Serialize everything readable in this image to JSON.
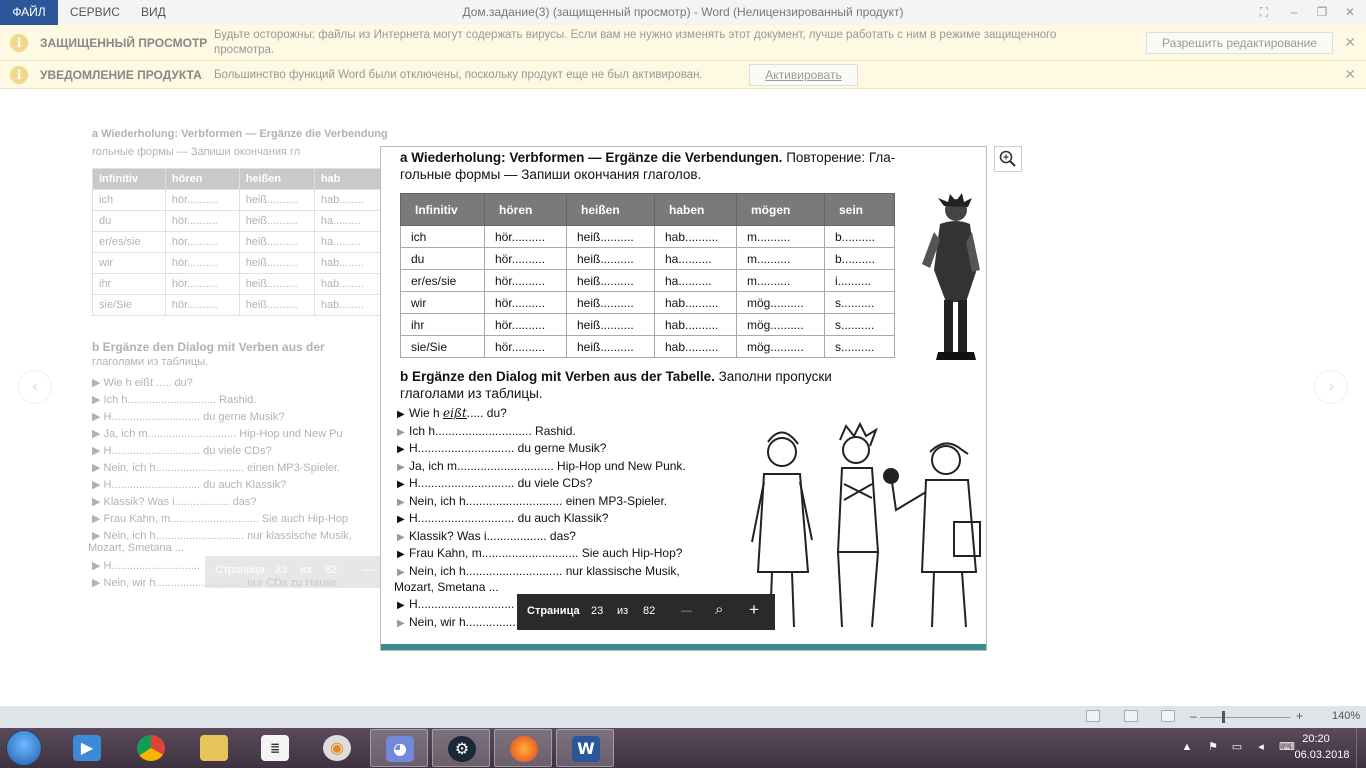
{
  "titlebar": {
    "menu": [
      "ФАЙЛ",
      "СЕРВИС",
      "ВИД"
    ],
    "title": "Дом.задание(3) (защищенный просмотр) - Word (Нелицензированный продукт)"
  },
  "protected_bar": {
    "title": "ЗАЩИЩЕННЫЙ ПРОСМОТР",
    "text_line1": "Будьте осторожны: файлы из Интернета могут содержать вирусы. Если вам не нужно изменять этот документ, лучше работать с ним в режиме защищенного",
    "text_line2": "просмотра.",
    "button": "Разрешить редактирование"
  },
  "product_bar": {
    "title": "УВЕДОМЛЕНИЕ ПРОДУКТА",
    "text": "Большинство функций Word были отключены, поскольку продукт еще не был активирован.",
    "button": "Активировать"
  },
  "background_page": {
    "heading_line1": "a  Wiederholung: Verbformen — Ergänze die Verbendungen. Повторение: Гла-",
    "heading_line2": "гольные формы — Запиши окончания гл",
    "table_headers": [
      "Infinitiv",
      "hören",
      "heißen",
      "hab"
    ],
    "table_rows": [
      [
        "ich",
        "hör..........",
        "heiß..........",
        "hab........"
      ],
      [
        "du",
        "hör..........",
        "heiß..........",
        "ha........."
      ],
      [
        "er/es/sie",
        "hör..........",
        "heiß..........",
        "ha........."
      ],
      [
        "wir",
        "hör..........",
        "heiß..........",
        "hab........"
      ],
      [
        "ihr",
        "hör..........",
        "heiß..........",
        "hab........"
      ],
      [
        "sie/Sie",
        "hör..........",
        "heiß..........",
        "hab........"
      ]
    ],
    "section_b_line1": "b  Ergänze den Dialog mit Verben aus der",
    "section_b_line2": "глаголами из таблицы.",
    "dialog": [
      "▶ Wie h  eißt  ..... du?",
      "▶ Ich h............................. Rashid.",
      "▶ H............................. du gerne Musik?",
      "▶ Ja, ich m............................. Hip-Hop und New Pu",
      "▶ H............................. du viele CDs?",
      "▶ Nein, ich h............................. einen MP3-Spieler.",
      "▶ H............................. du auch Klassik?",
      "▶ Klassik? Was i.................. das?",
      "▶ Frau Kahn, m............................. Sie auch Hip-Hop",
      "▶ Nein, ich h............................. nur klassische Musik,",
      "Mozart, Smetana ...",
      "▶ H.............................",
      "▶ Nein, wir h............................. nur CDs zu Hause."
    ],
    "pagebar": {
      "label": "Страница",
      "current": "23",
      "of": "из",
      "total": "82",
      "dash": "—"
    }
  },
  "zoom_image": {
    "heading_a_bold": "a  Wiederholung: Verbformen — Ergänze die Verbendungen.",
    "heading_a_rest": " Повторение: Гла-",
    "heading_a_line2": "гольные формы — Запиши окончания глаголов.",
    "table_headers": [
      "Infinitiv",
      "hören",
      "heißen",
      "haben",
      "mögen",
      "sein"
    ],
    "table_rows": [
      [
        "ich",
        "hör..........",
        "heiß..........",
        "hab..........",
        "m..........",
        "b.........."
      ],
      [
        "du",
        "hör..........",
        "heiß..........",
        "ha..........",
        "m..........",
        "b.........."
      ],
      [
        "er/es/sie",
        "hör..........",
        "heiß..........",
        "ha..........",
        "m..........",
        "i.........."
      ],
      [
        "wir",
        "hör..........",
        "heiß..........",
        "hab..........",
        "mög..........",
        "s.........."
      ],
      [
        "ihr",
        "hör..........",
        "heiß..........",
        "hab..........",
        "mög..........",
        "s.........."
      ],
      [
        "sie/Sie",
        "hör..........",
        "heiß..........",
        "hab..........",
        "mög..........",
        "s.........."
      ]
    ],
    "heading_b_bold": "b  Ergänze den Dialog mit Verben aus der Tabelle.",
    "heading_b_rest": " Заполни пропуски",
    "heading_b_line2": "глаголами из таблицы.",
    "dialog": [
      {
        "marker": "▶",
        "text": "Wie h ",
        "handwritten": "eißt",
        "after": "..... du?",
        "gray": false
      },
      {
        "marker": "▶",
        "text": "Ich h............................. Rashid.",
        "gray": true
      },
      {
        "marker": "▶",
        "text": "H............................. du gerne Musik?",
        "gray": false
      },
      {
        "marker": "▶",
        "text": "Ja, ich m............................. Hip-Hop und New Punk.",
        "gray": true
      },
      {
        "marker": "▶",
        "text": "H............................. du viele CDs?",
        "gray": false
      },
      {
        "marker": "▶",
        "text": "Nein, ich h............................. einen MP3-Spieler.",
        "gray": true
      },
      {
        "marker": "▶",
        "text": "H............................. du auch Klassik?",
        "gray": false
      },
      {
        "marker": "▶",
        "text": "Klassik? Was i.................. das?",
        "gray": true
      },
      {
        "marker": "▶",
        "text": "Frau Kahn, m............................. Sie auch Hip-Hop?",
        "gray": false
      },
      {
        "marker": "▶",
        "text": "Nein, ich h............................. nur klassische Musik,",
        "gray": true
      },
      {
        "marker": "",
        "text": "Mozart, Smetana ...",
        "gray": false
      },
      {
        "marker": "▶",
        "text": "H............................. Sie einen MP3-Spieler?",
        "gray": false
      },
      {
        "marker": "▶",
        "text": "Nein, wir h............................. nur CDs zu Hause.",
        "gray": true
      }
    ],
    "pagebar": {
      "label": "Страница",
      "current": "23",
      "of": "из",
      "total": "82"
    }
  },
  "statusbar": {
    "zoom": "140%"
  },
  "taskbar": {
    "apps": [
      "media-player",
      "chrome",
      "file-explorer",
      "notepad",
      "overwatch",
      "discord",
      "steam",
      "firefox",
      "word"
    ],
    "time": "20:20",
    "date": "06.03.2018"
  },
  "colors": {
    "word_blue": "#2b579a",
    "message_bar": "#fdf9e2",
    "taskbar": "#4b3d4b",
    "table_header": "#7a7a7a"
  }
}
